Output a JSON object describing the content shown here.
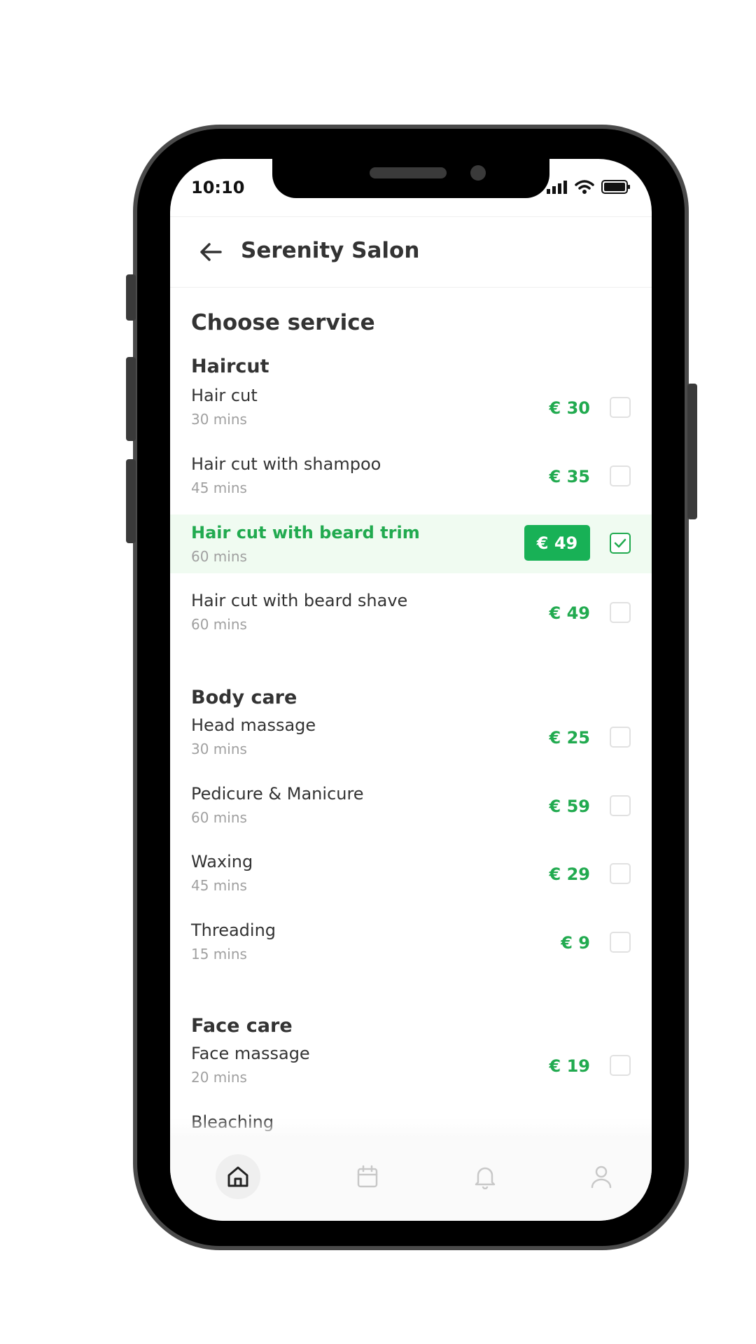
{
  "status_bar": {
    "time": "10:10"
  },
  "header": {
    "title": "Serenity Salon"
  },
  "page": {
    "title": "Choose service"
  },
  "sections": [
    {
      "title": "Haircut",
      "items": [
        {
          "name": "Hair cut",
          "duration": "30 mins",
          "price": "€ 30",
          "selected": false
        },
        {
          "name": "Hair cut with shampoo",
          "duration": "45 mins",
          "price": "€ 35",
          "selected": false
        },
        {
          "name": "Hair cut with beard trim",
          "duration": "60 mins",
          "price": "€ 49",
          "selected": true
        },
        {
          "name": "Hair cut with beard shave",
          "duration": "60 mins",
          "price": "€ 49",
          "selected": false
        }
      ]
    },
    {
      "title": "Body care",
      "items": [
        {
          "name": "Head massage",
          "duration": "30 mins",
          "price": "€ 25",
          "selected": false
        },
        {
          "name": "Pedicure & Manicure",
          "duration": "60 mins",
          "price": "€ 59",
          "selected": false
        },
        {
          "name": "Waxing",
          "duration": "45 mins",
          "price": "€ 29",
          "selected": false
        },
        {
          "name": "Threading",
          "duration": "15 mins",
          "price": "€ 9",
          "selected": false
        }
      ]
    },
    {
      "title": "Face care",
      "items": [
        {
          "name": "Face massage",
          "duration": "20 mins",
          "price": "€ 19",
          "selected": false
        },
        {
          "name": "Bleaching",
          "duration": "",
          "price": "",
          "selected": false
        }
      ]
    }
  ],
  "tabbar": [
    {
      "icon": "home-icon",
      "active": true
    },
    {
      "icon": "calendar-icon",
      "active": false
    },
    {
      "icon": "bell-icon",
      "active": false
    },
    {
      "icon": "user-icon",
      "active": false
    }
  ],
  "colors": {
    "accent": "#21aa4f",
    "accent_pill": "#18b156",
    "selected_row": "#f0fbf1",
    "text": "#333333",
    "muted": "#a0a0a0"
  }
}
